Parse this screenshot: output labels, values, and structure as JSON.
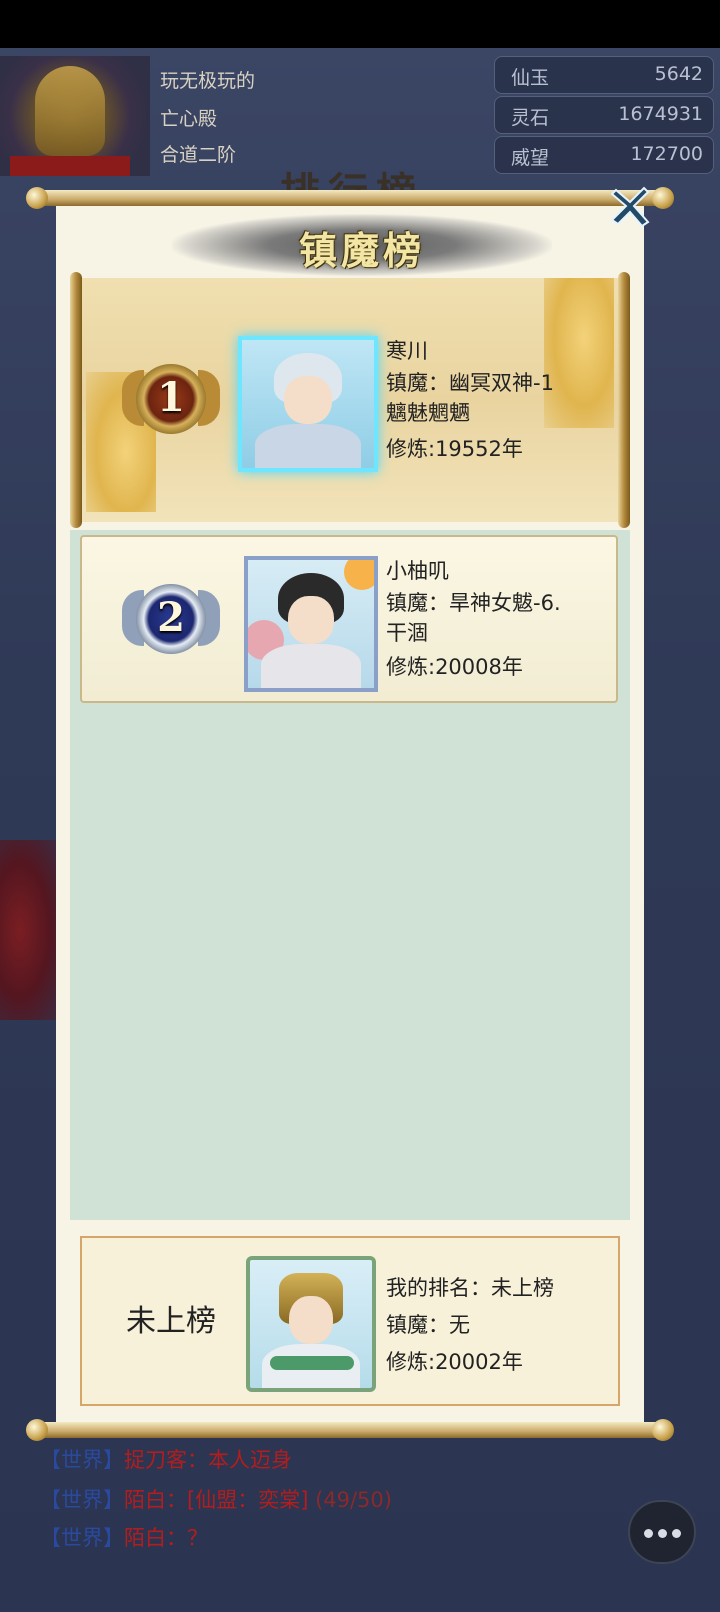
{
  "player": {
    "name": "玩无极玩的",
    "sect": "亡心殿",
    "realm": "合道二阶"
  },
  "resources": [
    {
      "label": "仙玉",
      "value": "5642"
    },
    {
      "label": "灵石",
      "value": "1674931"
    },
    {
      "label": "威望",
      "value": "172700"
    }
  ],
  "background_title": "排行榜",
  "panel": {
    "title": "镇魔榜",
    "close_icon": "close-x-icon",
    "entries": [
      {
        "rank": "1",
        "name": "寒川",
        "suppress": "镇魔：幽冥双神-1",
        "suppress_line2": "魑魅魍魉",
        "cultivation": "修炼:19552年"
      },
      {
        "rank": "2",
        "name": "小柚叽",
        "suppress": "镇魔：旱神女魃-6.",
        "suppress_line2": "干涸",
        "cultivation": "修炼:20008年"
      }
    ],
    "my_rank": {
      "rank_text": "未上榜",
      "label": "我的排名：未上榜",
      "suppress": "镇魔：无",
      "cultivation": "修炼:20002年"
    }
  },
  "chat": [
    {
      "channel": "【世界】",
      "speaker": "捉刀客：",
      "text": "本人迈身"
    },
    {
      "channel": "【世界】",
      "speaker": "陌白：",
      "text": "[仙盟：奕棠]",
      "extra": " (49/50)"
    },
    {
      "channel": "【世界】",
      "speaker": "陌白：",
      "text": "？"
    }
  ],
  "colors": {
    "accent_gold": "#c9a868",
    "list_bg": "#d0e2d5",
    "chat_red": "#b31d1d",
    "chat_blue": "#2a4aa0"
  }
}
